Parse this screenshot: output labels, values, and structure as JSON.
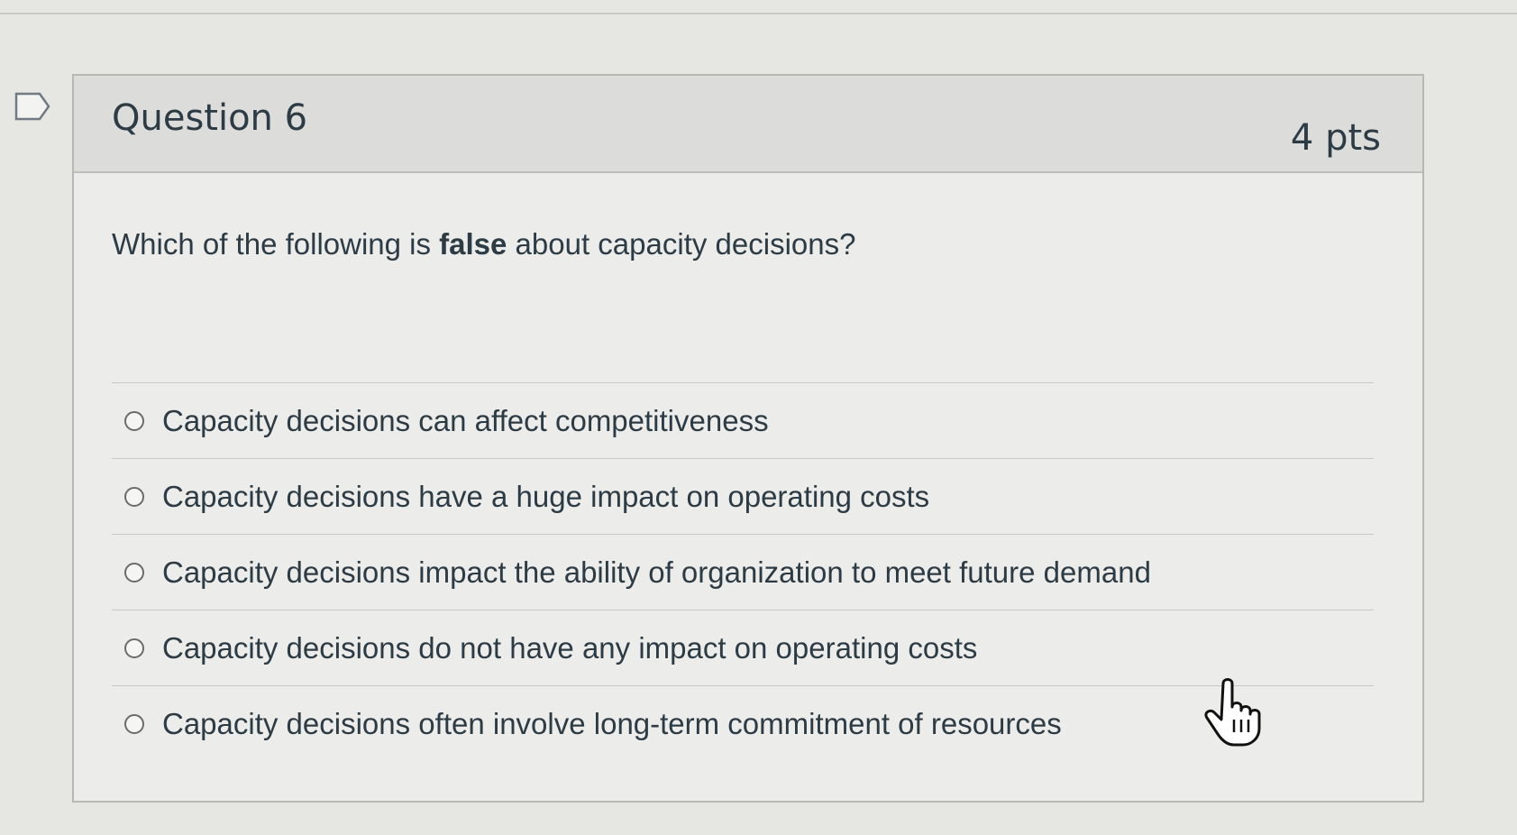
{
  "question": {
    "title": "Question 6",
    "points": "4 pts",
    "prompt_before": "Which of the following is ",
    "prompt_bold": "false",
    "prompt_after": " about capacity decisions?"
  },
  "answers": [
    {
      "label": "Capacity decisions can affect competitiveness"
    },
    {
      "label": "Capacity decisions have a huge impact on operating costs"
    },
    {
      "label": "Capacity decisions impact the ability of organization to meet future demand"
    },
    {
      "label": "Capacity decisions do not have any impact on operating costs"
    },
    {
      "label": "Capacity decisions often involve long-term commitment of resources"
    }
  ],
  "icons": {
    "flag": "flag-question-icon",
    "cursor": "hand-pointer-icon"
  },
  "colors": {
    "text": "#2d3b45",
    "header_bg": "#dcdcda",
    "body_bg": "#ececea"
  }
}
